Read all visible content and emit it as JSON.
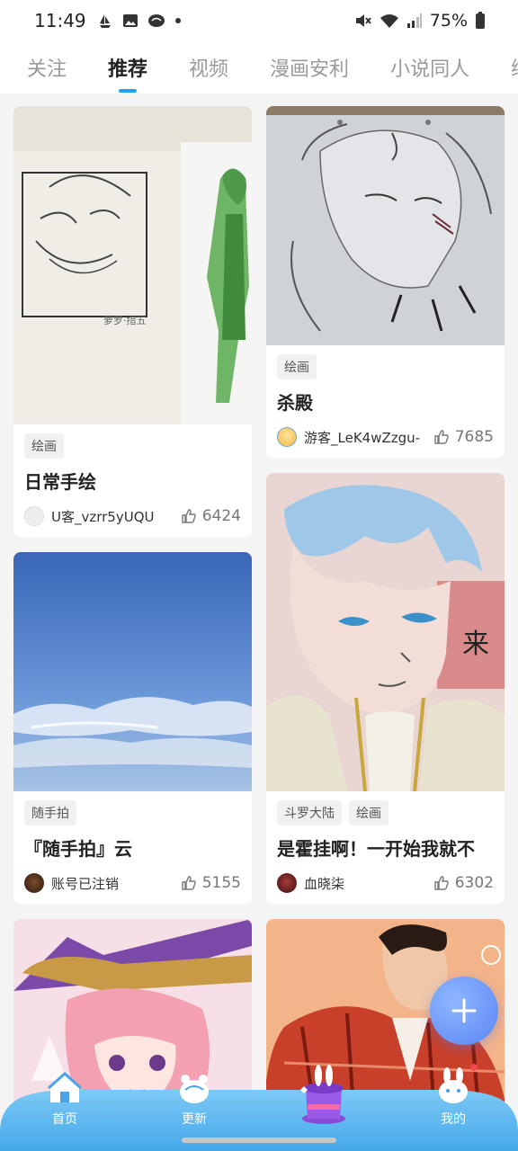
{
  "status": {
    "time": "11:49",
    "battery": "75%"
  },
  "tabs": [
    "关注",
    "推荐",
    "视频",
    "漫画安利",
    "小说同人",
    "绘"
  ],
  "cards": [
    {
      "tags": [
        "绘画"
      ],
      "title": "日常手绘",
      "author": "U客_vzrr5yUQU",
      "likes": "6424"
    },
    {
      "tags": [
        "绘画"
      ],
      "title": "杀殿",
      "author": "游客_LeK4wZzgu-",
      "likes": "7685"
    },
    {
      "tags": [
        "随手拍"
      ],
      "title": "『随手拍』云",
      "author": "账号已注销",
      "likes": "5155"
    },
    {
      "tags": [
        "斗罗大陆",
        "绘画"
      ],
      "title": "是霍挂啊！一开始我就不",
      "author": "血晓柒",
      "likes": "6302"
    }
  ],
  "nav": {
    "home": "首页",
    "update": "更新",
    "mine": "我的"
  },
  "colors": {
    "accent": "#28a0e8",
    "nav_bar": "#5db8f0",
    "fab": "#5a86f5"
  }
}
